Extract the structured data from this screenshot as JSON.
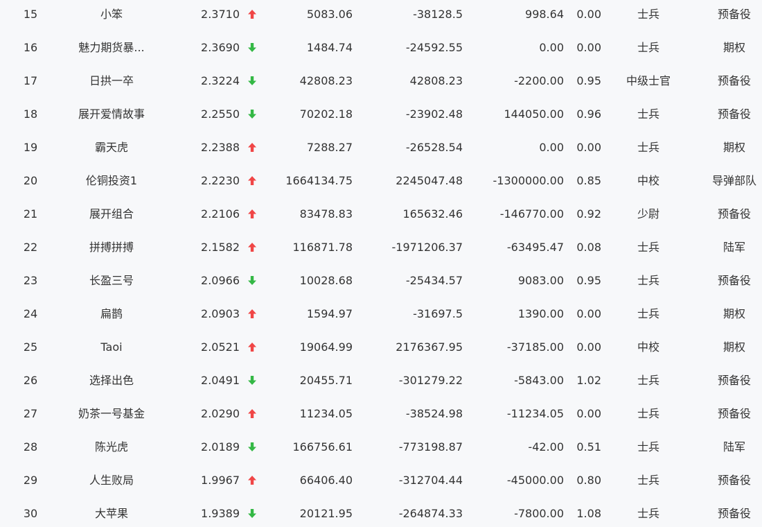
{
  "colors": {
    "up": "#f04646",
    "down": "#34b845",
    "text": "#333333",
    "background": "#f7f8fa"
  },
  "rows": [
    {
      "rank": "15",
      "name": "小笨",
      "score": "2.3710",
      "trend": "up",
      "v1": "5083.06",
      "v2": "-38128.5",
      "v3": "998.64",
      "v4": "0.00",
      "rank_name": "士兵",
      "type": "预备役"
    },
    {
      "rank": "16",
      "name": "魅力期货暴...",
      "score": "2.3690",
      "trend": "down",
      "v1": "1484.74",
      "v2": "-24592.55",
      "v3": "0.00",
      "v4": "0.00",
      "rank_name": "士兵",
      "type": "期权"
    },
    {
      "rank": "17",
      "name": "日拱一卒",
      "score": "2.3224",
      "trend": "down",
      "v1": "42808.23",
      "v2": "42808.23",
      "v3": "-2200.00",
      "v4": "0.95",
      "rank_name": "中级士官",
      "type": "预备役"
    },
    {
      "rank": "18",
      "name": "展开爱情故事",
      "score": "2.2550",
      "trend": "down",
      "v1": "70202.18",
      "v2": "-23902.48",
      "v3": "144050.00",
      "v4": "0.96",
      "rank_name": "士兵",
      "type": "预备役"
    },
    {
      "rank": "19",
      "name": "霸天虎",
      "score": "2.2388",
      "trend": "up",
      "v1": "7288.27",
      "v2": "-26528.54",
      "v3": "0.00",
      "v4": "0.00",
      "rank_name": "士兵",
      "type": "期权"
    },
    {
      "rank": "20",
      "name": "伦铜投资1",
      "score": "2.2230",
      "trend": "up",
      "v1": "1664134.75",
      "v2": "2245047.48",
      "v3": "-1300000.00",
      "v4": "0.85",
      "rank_name": "中校",
      "type": "导弹部队"
    },
    {
      "rank": "21",
      "name": "展开组合",
      "score": "2.2106",
      "trend": "up",
      "v1": "83478.83",
      "v2": "165632.46",
      "v3": "-146770.00",
      "v4": "0.92",
      "rank_name": "少尉",
      "type": "预备役"
    },
    {
      "rank": "22",
      "name": "拼搏拼搏",
      "score": "2.1582",
      "trend": "up",
      "v1": "116871.78",
      "v2": "-1971206.37",
      "v3": "-63495.47",
      "v4": "0.08",
      "rank_name": "士兵",
      "type": "陆军"
    },
    {
      "rank": "23",
      "name": "长盈三号",
      "score": "2.0966",
      "trend": "down",
      "v1": "10028.68",
      "v2": "-25434.57",
      "v3": "9083.00",
      "v4": "0.95",
      "rank_name": "士兵",
      "type": "预备役"
    },
    {
      "rank": "24",
      "name": "扁鹊",
      "score": "2.0903",
      "trend": "up",
      "v1": "1594.97",
      "v2": "-31697.5",
      "v3": "1390.00",
      "v4": "0.00",
      "rank_name": "士兵",
      "type": "期权"
    },
    {
      "rank": "25",
      "name": "Taoi",
      "score": "2.0521",
      "trend": "up",
      "v1": "19064.99",
      "v2": "2176367.95",
      "v3": "-37185.00",
      "v4": "0.00",
      "rank_name": "中校",
      "type": "期权"
    },
    {
      "rank": "26",
      "name": "选择出色",
      "score": "2.0491",
      "trend": "down",
      "v1": "20455.71",
      "v2": "-301279.22",
      "v3": "-5843.00",
      "v4": "1.02",
      "rank_name": "士兵",
      "type": "预备役"
    },
    {
      "rank": "27",
      "name": "奶茶一号基金",
      "score": "2.0290",
      "trend": "up",
      "v1": "11234.05",
      "v2": "-38524.98",
      "v3": "-11234.05",
      "v4": "0.00",
      "rank_name": "士兵",
      "type": "预备役"
    },
    {
      "rank": "28",
      "name": "陈光虎",
      "score": "2.0189",
      "trend": "down",
      "v1": "166756.61",
      "v2": "-773198.87",
      "v3": "-42.00",
      "v4": "0.51",
      "rank_name": "士兵",
      "type": "陆军"
    },
    {
      "rank": "29",
      "name": "人生败局",
      "score": "1.9967",
      "trend": "up",
      "v1": "66406.40",
      "v2": "-312704.44",
      "v3": "-45000.00",
      "v4": "0.80",
      "rank_name": "士兵",
      "type": "预备役"
    },
    {
      "rank": "30",
      "name": "大苹果",
      "score": "1.9389",
      "trend": "down",
      "v1": "20121.95",
      "v2": "-264874.33",
      "v3": "-7800.00",
      "v4": "1.08",
      "rank_name": "士兵",
      "type": "预备役"
    }
  ]
}
